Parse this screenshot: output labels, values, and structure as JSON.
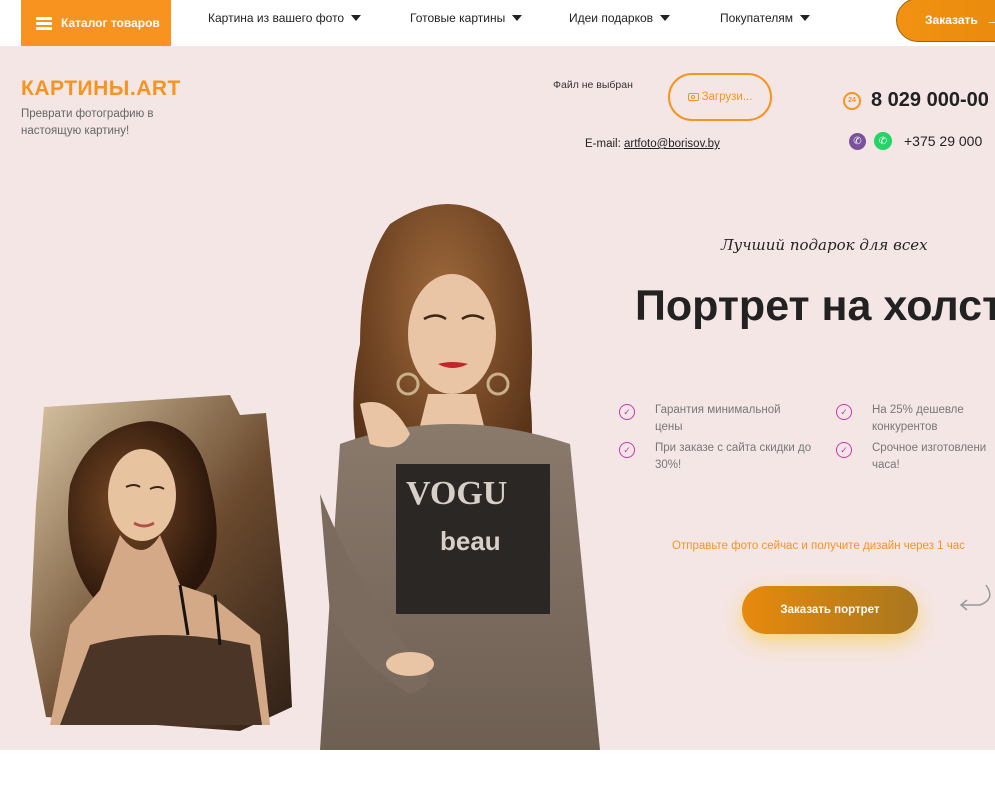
{
  "nav": {
    "catalog_label": "Каталог товаров",
    "items": [
      {
        "label": "Картина из вашего фото"
      },
      {
        "label": "Готовые картины"
      },
      {
        "label": "Идеи подарков"
      },
      {
        "label": "Покупателям"
      }
    ],
    "order_label": "Заказать",
    "order_arrow": "→"
  },
  "header": {
    "logo": "КАРТИНЫ.ART",
    "tagline": "Преврати фотографию в настоящую картину!",
    "file_status": "Файл не выбран",
    "upload_label": "Загрузи...",
    "email_label": "E-mail:",
    "email": "artfoto@borisov.by",
    "clock_label": "24",
    "phone_main": "8 029 000-00",
    "phone_messengers": "+375 29 000"
  },
  "hero": {
    "subtitle": "Лучший подарок для всех",
    "headline": "Портрет на холст",
    "features": [
      {
        "text": "Гарантия минимальной цены"
      },
      {
        "text": "При заказе с сайта скидки до 30%!"
      },
      {
        "text": "На 25% дешевле конкурентов"
      },
      {
        "text": "Срочное изготовлени часа!"
      }
    ],
    "cta_text": "Отправьте фото сейчас и получите дизайн через 1 час",
    "cta_button": "Заказать портрет"
  },
  "icons": {
    "menu": "burger-menu-icon",
    "caret": "chevron-down-icon",
    "camera": "camera-icon",
    "clock": "clock-24-icon",
    "viber": "viber-icon",
    "whatsapp": "whatsapp-icon",
    "check": "check-circle-icon",
    "arrow": "curved-arrow-icon"
  },
  "colors": {
    "accent": "#f7931e",
    "hero_bg": "#f5e6e6",
    "check": "#c43aa9",
    "viber": "#7b519d",
    "whatsapp": "#25d366"
  }
}
